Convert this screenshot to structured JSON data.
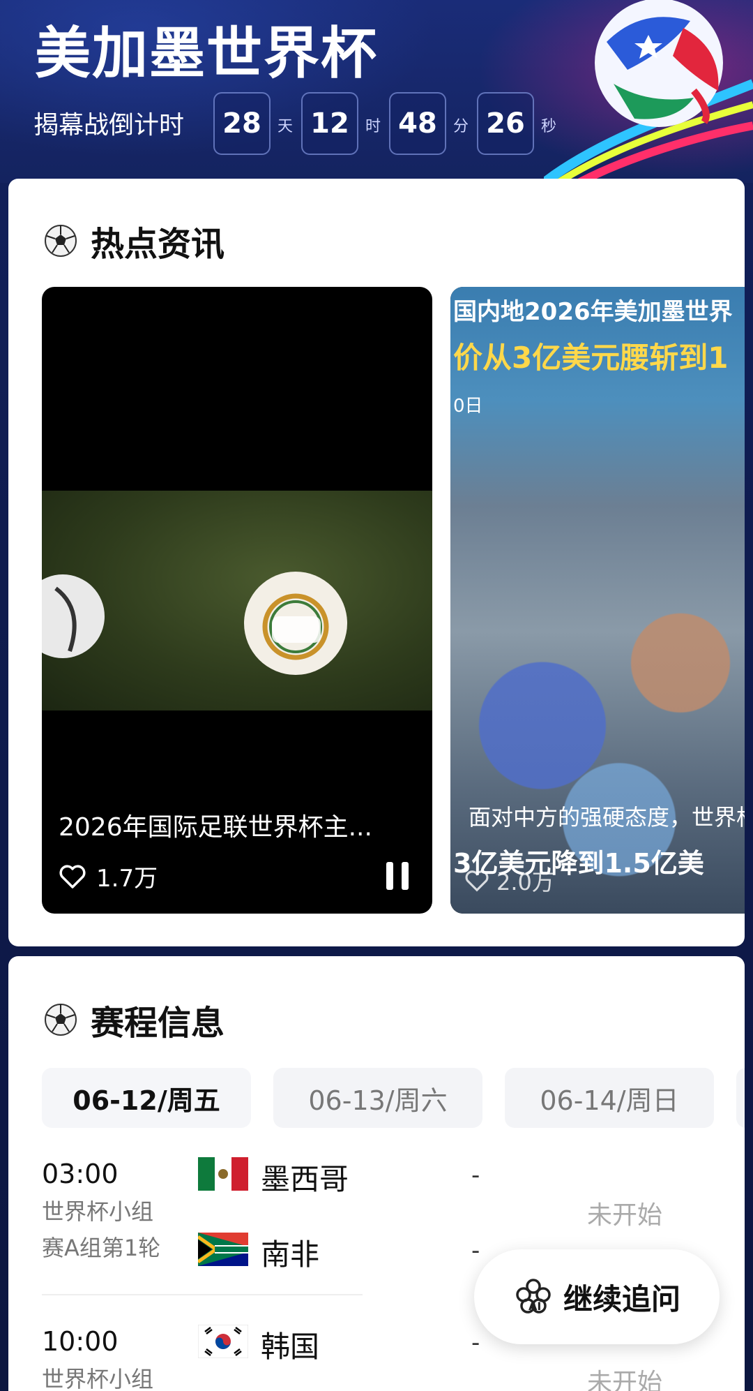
{
  "header": {
    "title": "美加墨世界杯",
    "countdown_label": "揭幕战倒计时",
    "countdown": {
      "days": "28",
      "days_unit": "天",
      "hours": "12",
      "hours_unit": "时",
      "minutes": "48",
      "minutes_unit": "分",
      "seconds": "26",
      "seconds_unit": "秒"
    }
  },
  "news": {
    "section_title": "热点资讯",
    "items": [
      {
        "caption": "2026年国际足联世界杯主...",
        "likes": "1.7万"
      },
      {
        "headline": "国内地2026年美加墨世界",
        "subheadline": "价从3亿美元腰斩到1",
        "date_fragment": "0日",
        "caption_line1": "面对中方的强硬态度，世界杯转播费",
        "caption_line2": "3亿美元降到1.5亿美",
        "likes": "2.0万"
      }
    ]
  },
  "schedule": {
    "section_title": "赛程信息",
    "date_tabs": [
      "06-12/周五",
      "06-13/周六",
      "06-14/周日"
    ],
    "matches": [
      {
        "time": "03:00",
        "stage_line1": "世界杯小组",
        "stage_line2": "赛A组第1轮",
        "home": "墨西哥",
        "away": "南非",
        "home_score": "-",
        "away_score": "-",
        "status": "未开始"
      },
      {
        "time": "10:00",
        "stage_line1": "世界杯小组",
        "home": "韩国",
        "home_score": "-",
        "status": "未开始"
      }
    ]
  },
  "followup_button": "继续追问",
  "colors": {
    "header_bg": "#1a2c78",
    "card_bg": "#ffffff",
    "tab_active_text": "#111111",
    "tab_inactive_text": "#777777",
    "status_text": "#aaaaaa",
    "news_subheadline": "#ffd84a"
  }
}
